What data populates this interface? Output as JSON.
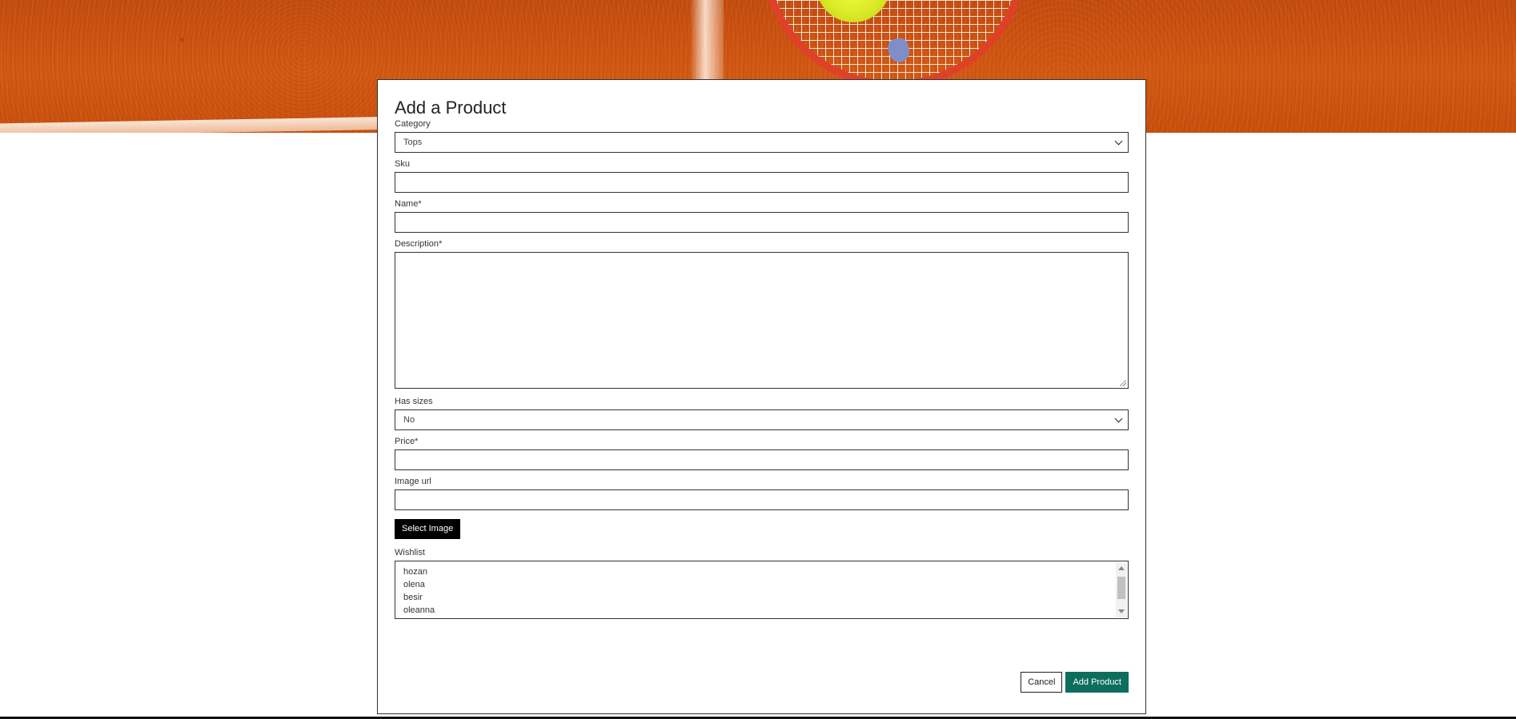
{
  "form": {
    "title": "Add a Product",
    "category": {
      "label": "Category",
      "value": "Tops"
    },
    "sku": {
      "label": "Sku",
      "value": ""
    },
    "name": {
      "label": "Name*",
      "value": ""
    },
    "description": {
      "label": "Description*",
      "value": ""
    },
    "has_sizes": {
      "label": "Has sizes",
      "value": "No"
    },
    "price": {
      "label": "Price*",
      "value": ""
    },
    "image_url": {
      "label": "Image url",
      "value": ""
    },
    "select_image_label": "Select Image",
    "wishlist": {
      "label": "Wishlist",
      "options": [
        "hozan",
        "olena",
        "besir",
        "oleanna"
      ]
    },
    "cancel_label": "Cancel",
    "submit_label": "Add Product"
  },
  "colors": {
    "primary_button": "#0d6e5d",
    "select_image_button": "#000000"
  }
}
